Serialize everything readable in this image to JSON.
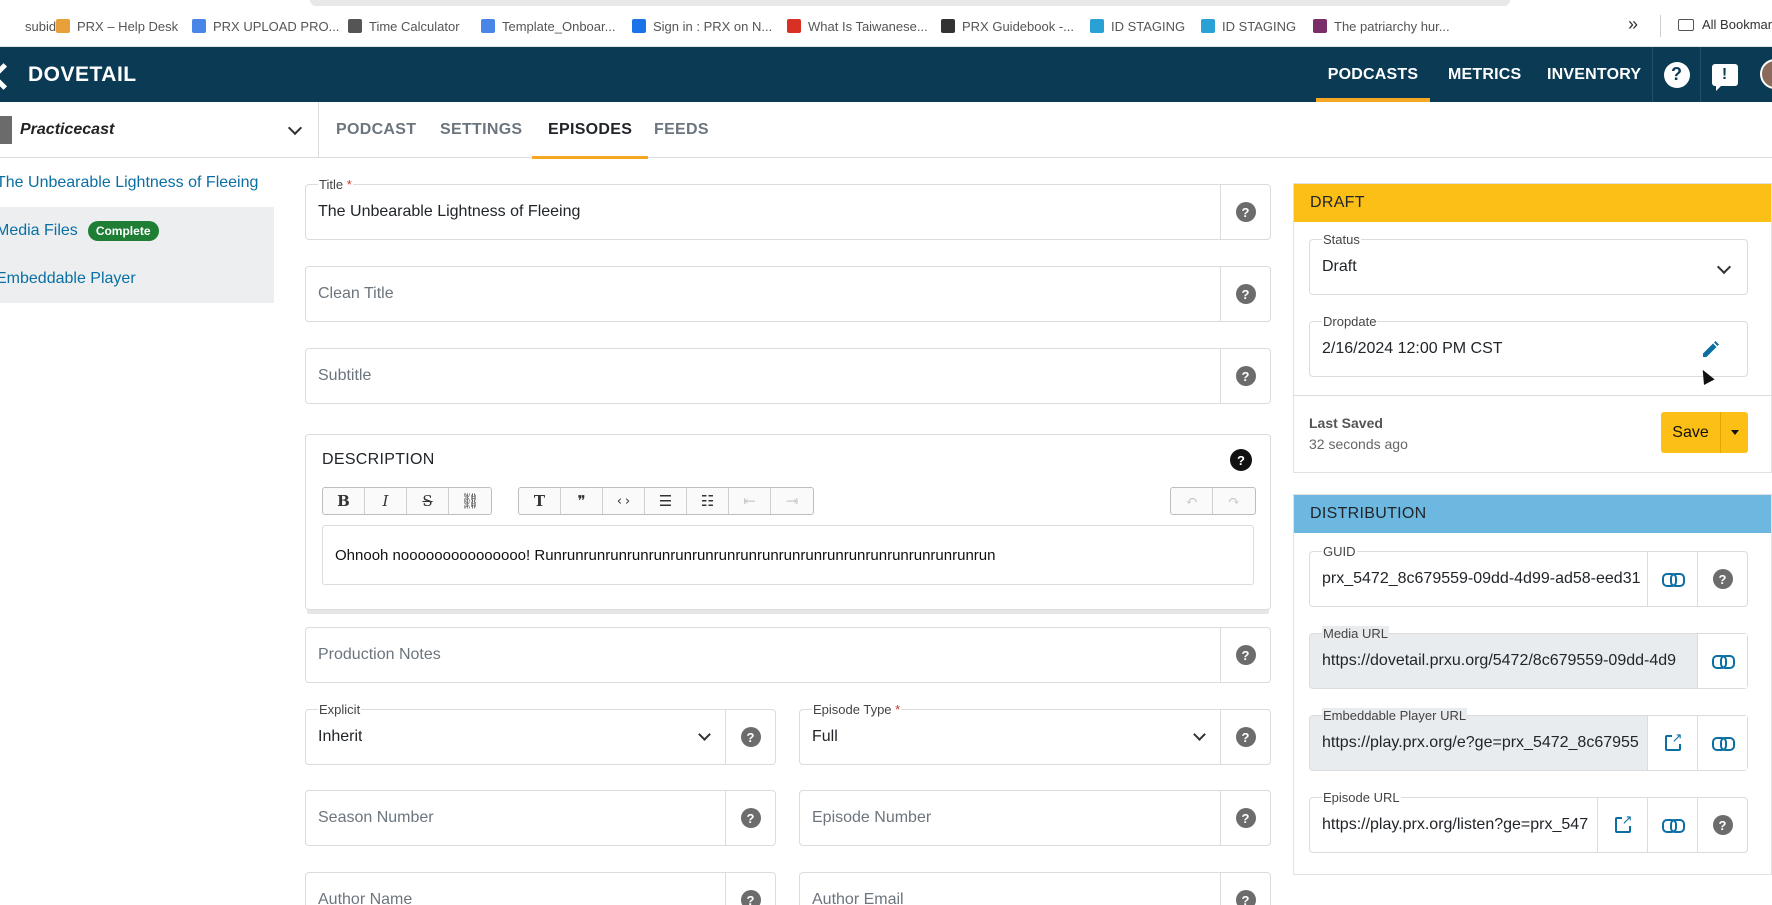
{
  "bookmarks": [
    {
      "label": "subid",
      "icon": "blank-icon",
      "color": "#ffffff"
    },
    {
      "label": "PRX – Help Desk",
      "icon": "helpdesk-icon",
      "color": "#e8a13a"
    },
    {
      "label": "PRX UPLOAD PRO...",
      "icon": "docs-icon",
      "color": "#4a86e8"
    },
    {
      "label": "Time Calculator",
      "icon": "calculator-icon",
      "color": "#555555"
    },
    {
      "label": "Template_Onboar...",
      "icon": "docs-icon",
      "color": "#4a86e8"
    },
    {
      "label": "Sign in : PRX on N...",
      "icon": "signin-icon",
      "color": "#1a73e8"
    },
    {
      "label": "What Is Taiwanese...",
      "icon": "e-icon",
      "color": "#d93025"
    },
    {
      "label": "PRX Guidebook -...",
      "icon": "globe-icon",
      "color": "#333333"
    },
    {
      "label": "ID STAGING",
      "icon": "x-icon",
      "color": "#2aa1d4"
    },
    {
      "label": "ID STAGING",
      "icon": "x-icon",
      "color": "#2aa1d4"
    },
    {
      "label": "The patriarchy hur...",
      "icon": "s-icon",
      "color": "#7b2d6a"
    }
  ],
  "bookmarks_more": "»",
  "all_bookmarks": "All Bookmarks",
  "brand": "DOVETAIL",
  "nav": {
    "podcasts": "PODCASTS",
    "metrics": "METRICS",
    "inventory": "INVENTORY",
    "help": "?",
    "feedback": "!"
  },
  "podcast_name": "Practicecast",
  "tabs": [
    "PODCAST",
    "SETTINGS",
    "EPISODES",
    "FEEDS"
  ],
  "sidebar": {
    "episode_title": "The Unbearable Lightness of Fleeing",
    "media_files": "Media Files",
    "media_badge": "Complete",
    "embeddable_player": "Embeddable Player"
  },
  "form": {
    "title_label": "Title",
    "required_mark": "*",
    "title_value": "The Unbearable Lightness of Fleeing",
    "clean_title_ph": "Clean Title",
    "subtitle_ph": "Subtitle",
    "description_heading": "DESCRIPTION",
    "description_text": "Ohnooh nooooooooooooooo! Runrunrunrunrunrunrunrunrunrunrunrunrunrunrunrunrunrunrunrunrun",
    "production_notes_ph": "Production Notes",
    "explicit_label": "Explicit",
    "explicit_value": "Inherit",
    "episode_type_label": "Episode Type",
    "episode_type_value": "Full",
    "season_number_ph": "Season Number",
    "episode_number_ph": "Episode Number",
    "author_name_ph": "Author Name",
    "author_email_ph": "Author Email",
    "help": "?"
  },
  "toolbar": {
    "bold": "B",
    "italic": "I",
    "strike": "S",
    "link": "⛓",
    "heading": "T",
    "quote": "❞",
    "code": "‹›",
    "bullets": "☰",
    "numbered": "☷",
    "outdent": "⇤",
    "indent": "⇥",
    "undo": "↶",
    "redo": "↷"
  },
  "draft": {
    "heading": "DRAFT",
    "status_label": "Status",
    "status_value": "Draft",
    "dropdate_label": "Dropdate",
    "dropdate_value": "2/16/2024 12:00 PM CST",
    "last_saved_label": "Last Saved",
    "last_saved_value": "32 seconds ago",
    "save": "Save"
  },
  "distribution": {
    "heading": "DISTRIBUTION",
    "guid_label": "GUID",
    "guid_value": "prx_5472_8c679559-09dd-4d99-ad58-eed31",
    "media_url_label": "Media URL",
    "media_url_value": "https://dovetail.prxu.org/5472/8c679559-09dd-4d9",
    "player_url_label": "Embeddable Player URL",
    "player_url_value": "https://play.prx.org/e?ge=prx_5472_8c67955",
    "episode_url_label": "Episode URL",
    "episode_url_value": "https://play.prx.org/listen?ge=prx_547"
  },
  "colors": {
    "navbar": "#0b3a55",
    "accent": "#f5a623",
    "draft": "#fbbf16",
    "distribution": "#6cb8e0",
    "link": "#0b6fa4",
    "badge": "#1e7e34"
  }
}
